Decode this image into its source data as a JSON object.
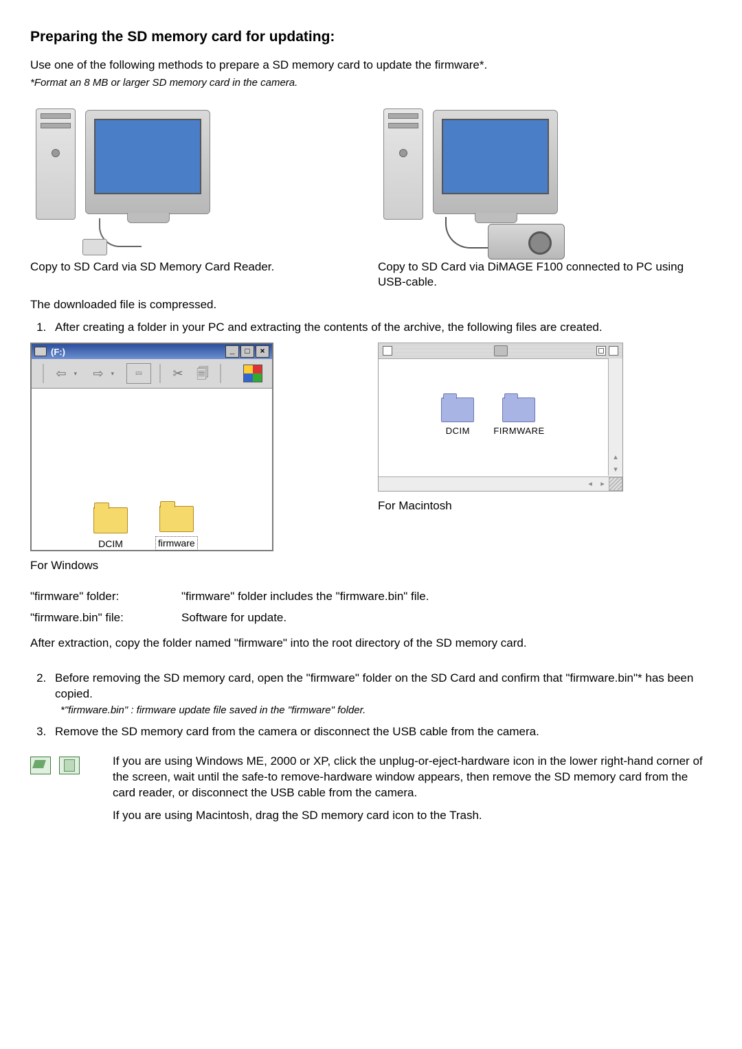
{
  "title": "Preparing the SD memory card for updating:",
  "intro": "Use one of the following methods to prepare a SD memory card to update the firmware*.",
  "intro_note": "*Format an 8 MB or larger SD memory card in the camera.",
  "caption_left": "Copy to SD Card via SD Memory Card Reader.",
  "caption_right": "Copy to SD Card via DiMAGE F100 connected to PC using USB-cable.",
  "compressed_line": "The downloaded file is compressed.",
  "step1": "After creating a folder in your PC and extracting the contents of the archive, the following files are created.",
  "windows_explorer": {
    "drive_label": "(F:)",
    "min_char": "_",
    "max_char": "□",
    "close_char": "×",
    "folders": [
      "DCIM",
      "firmware"
    ]
  },
  "mac_finder": {
    "folders": [
      "DCIM",
      "FIRMWARE"
    ]
  },
  "os_caption_left": "For Windows",
  "os_caption_right": "For Macintosh",
  "defs": {
    "firmware_folder_key": "\"firmware\" folder:",
    "firmware_folder_val": "\"firmware\" folder includes the \"firmware.bin\" file.",
    "firmware_bin_key": "\"firmware.bin\" file:",
    "firmware_bin_val": "Software for update."
  },
  "after_extraction": "After extraction, copy the folder named \"firmware\" into the root directory of the SD memory card.",
  "step2": "Before removing the SD memory card, open the \"firmware\" folder on the SD Card and confirm that \"firmware.bin\"* has been copied.",
  "step2_note": "*\"firmware.bin\" : firmware update file saved in the \"firmware\" folder.",
  "step3": "Remove the SD memory card from the camera or disconnect the USB cable from the camera.",
  "tray_para1": "If you are using Windows ME, 2000 or XP, click the unplug-or-eject-hardware icon  in the lower right-hand corner of the screen, wait until the safe-to remove-hardware window appears, then remove the SD memory card from the card reader, or disconnect the USB cable from the camera.",
  "tray_para2": "If you are using Macintosh, drag the SD memory card icon to the Trash."
}
